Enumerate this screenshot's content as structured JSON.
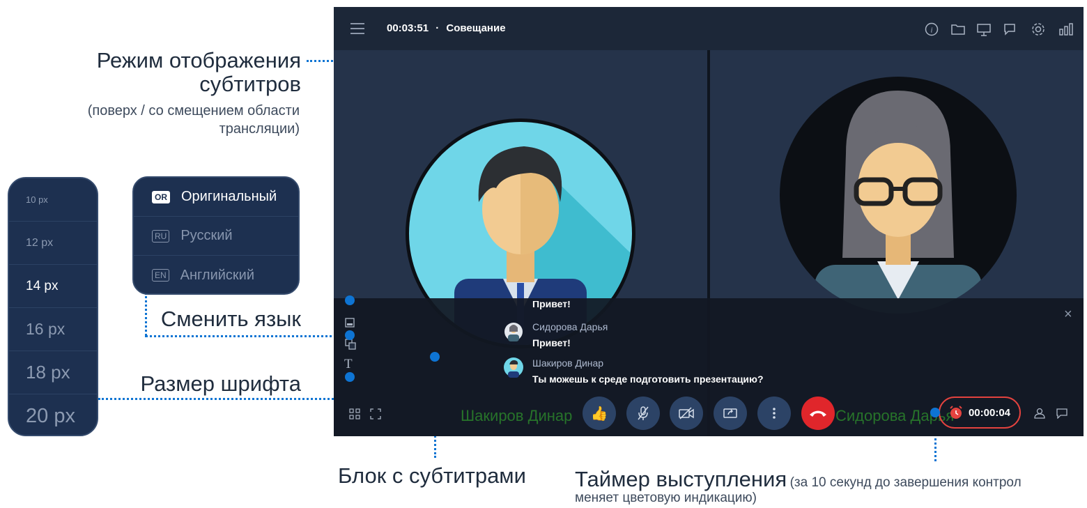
{
  "annotations": {
    "display_mode_title_1": "Режим отображения",
    "display_mode_title_2": "субтитров",
    "display_mode_sub_1": "(поверх / со смещением области",
    "display_mode_sub_2": "трансляции)",
    "change_language": "Сменить язык",
    "font_size": "Размер шрифта",
    "subtitle_block": "Блок с субтитрами",
    "timer_title": "Таймер выступления",
    "timer_sub_1": "(за 10 секунд до завершения контрол",
    "timer_sub_2": "меняет цветовую индикацию)"
  },
  "font_sizes": [
    "10 px",
    "12 px",
    "14 px",
    "16 px",
    "18 px",
    "20 px"
  ],
  "languages": [
    {
      "code": "OR",
      "label": "Оригинальный",
      "active": true
    },
    {
      "code": "RU",
      "label": "Русский",
      "active": false
    },
    {
      "code": "EN",
      "label": "Английский",
      "active": false
    }
  ],
  "meeting": {
    "elapsed": "00:03:51",
    "separator": "·",
    "title": "Совещание",
    "top_icons": [
      "info-icon",
      "folder-icon",
      "presentation-icon",
      "chat-icon",
      "settings-icon",
      "stats-icon"
    ],
    "participants": [
      "Шакиров Динар",
      "Сидорова Дарья"
    ],
    "subtitles": {
      "partial_line": "Привет!",
      "messages": [
        {
          "name": "Сидорова Дарья",
          "text": "Привет!"
        },
        {
          "name": "Шакиров Динар",
          "text": "Ты можешь к среде подготовить презентацию?"
        }
      ],
      "close_glyph": "×"
    },
    "speaker_timer": "00:00:04",
    "colors": {
      "accent": "#0e74d3",
      "hangup": "#e0262b",
      "timer_border": "#e4433f",
      "panel": "#1d3050"
    }
  }
}
